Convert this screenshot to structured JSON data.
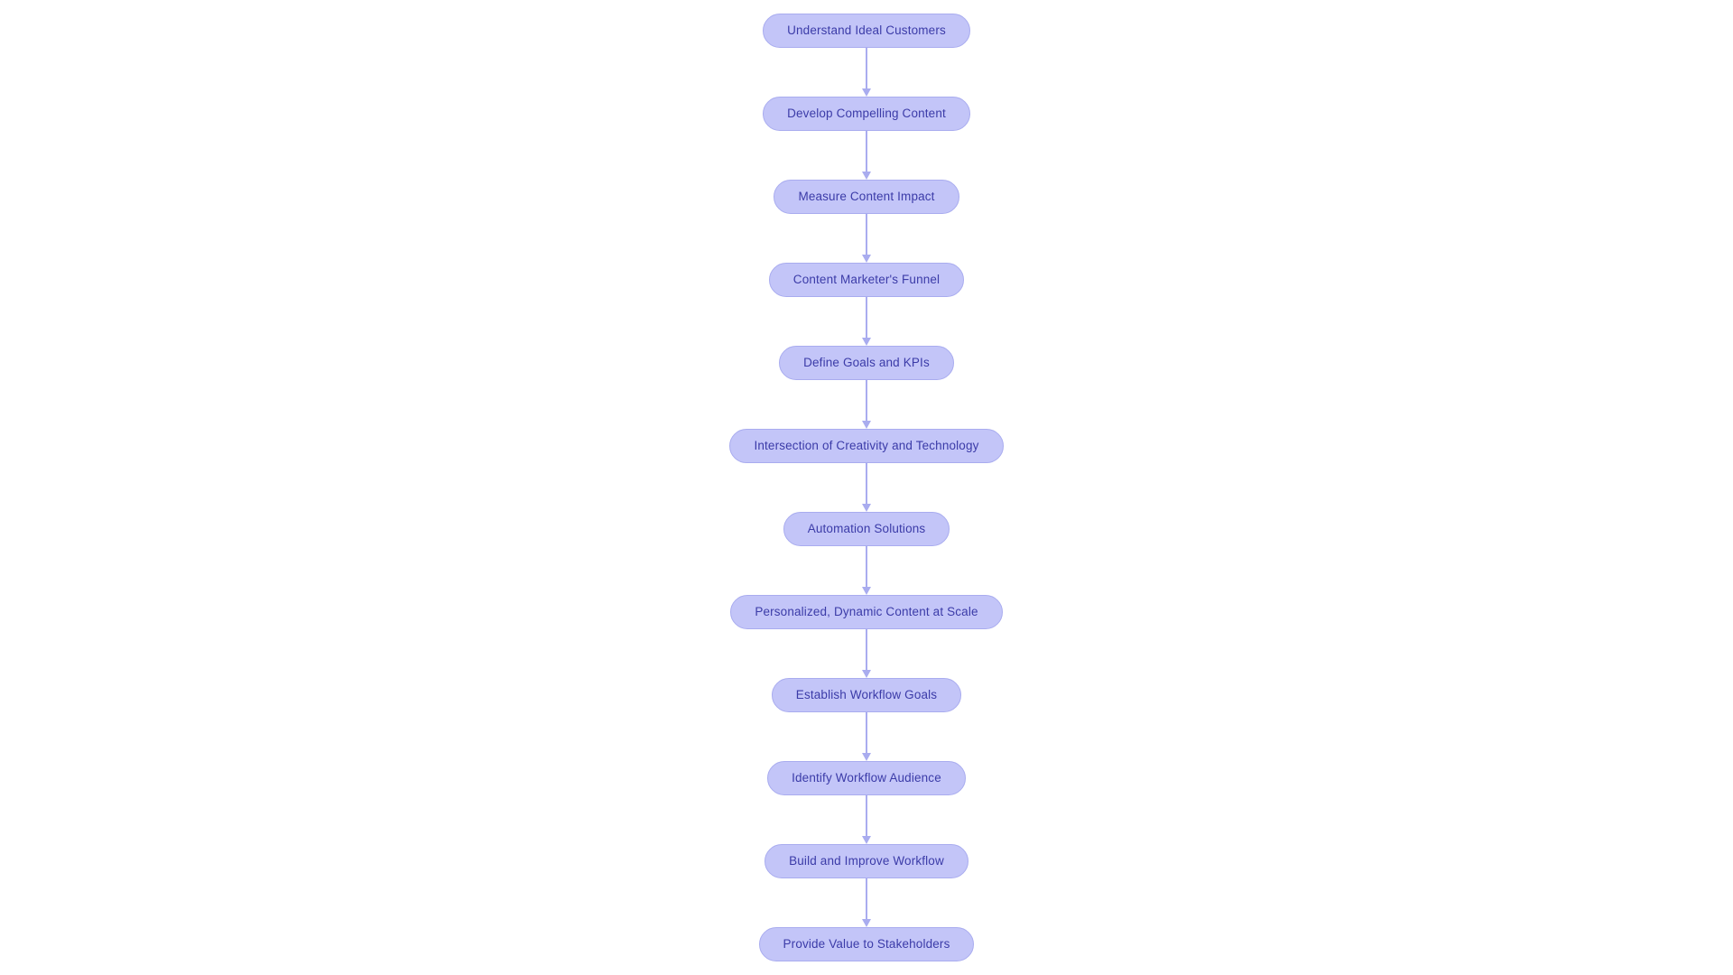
{
  "diagram": {
    "type": "flowchart",
    "orientation": "vertical",
    "background_color": "#ffffff",
    "node_fill_color": "#c3c5f8",
    "node_border_color": "#a9acef",
    "node_text_color": "#3b3ba8",
    "connector_color": "#a9acef",
    "nodes": [
      {
        "id": "n1",
        "label": "Understand Ideal Customers"
      },
      {
        "id": "n2",
        "label": "Develop Compelling Content"
      },
      {
        "id": "n3",
        "label": "Measure Content Impact"
      },
      {
        "id": "n4",
        "label": "Content Marketer's Funnel"
      },
      {
        "id": "n5",
        "label": "Define Goals and KPIs"
      },
      {
        "id": "n6",
        "label": "Intersection of Creativity and Technology"
      },
      {
        "id": "n7",
        "label": "Automation Solutions"
      },
      {
        "id": "n8",
        "label": "Personalized, Dynamic Content at Scale"
      },
      {
        "id": "n9",
        "label": "Establish Workflow Goals"
      },
      {
        "id": "n10",
        "label": "Identify Workflow Audience"
      },
      {
        "id": "n11",
        "label": "Build and Improve Workflow"
      },
      {
        "id": "n12",
        "label": "Provide Value to Stakeholders"
      }
    ],
    "edges": [
      {
        "from": "n1",
        "to": "n2",
        "arrow": "down-arrow-icon"
      },
      {
        "from": "n2",
        "to": "n3",
        "arrow": "down-arrow-icon"
      },
      {
        "from": "n3",
        "to": "n4",
        "arrow": "down-arrow-icon"
      },
      {
        "from": "n4",
        "to": "n5",
        "arrow": "down-arrow-icon"
      },
      {
        "from": "n5",
        "to": "n6",
        "arrow": "down-arrow-icon"
      },
      {
        "from": "n6",
        "to": "n7",
        "arrow": "down-arrow-icon"
      },
      {
        "from": "n7",
        "to": "n8",
        "arrow": "down-arrow-icon"
      },
      {
        "from": "n8",
        "to": "n9",
        "arrow": "down-arrow-icon"
      },
      {
        "from": "n9",
        "to": "n10",
        "arrow": "down-arrow-icon"
      },
      {
        "from": "n10",
        "to": "n11",
        "arrow": "down-arrow-icon"
      },
      {
        "from": "n11",
        "to": "n12",
        "arrow": "down-arrow-icon"
      }
    ]
  }
}
